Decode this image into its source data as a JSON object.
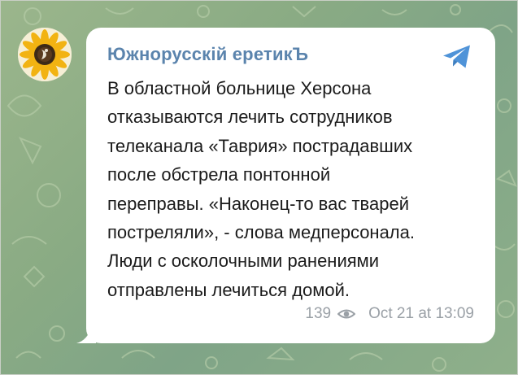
{
  "post": {
    "channel_name": "Южнорусскій еретикЪ",
    "text": "В областной больнице Херсона\nотказываются лечить сотрудников\nтелеканала «Таврия» пострадавших\nпосле обстрела понтонной\nпереправы. «Наконец-то вас тварей\nпостреляли», - слова медперсонала.\nЛюди с осколочными ранениями\nотправлены лечиться домой.",
    "views": "139",
    "timestamp": "Oct 21 at 13:09"
  },
  "icons": {
    "share": "telegram-send-icon",
    "views": "eye-icon",
    "avatar": "sunflower-logo"
  },
  "colors": {
    "sender": "#5b84ad",
    "share_icon": "#4f93d8",
    "meta": "#9aa0a6",
    "background": "#8aab84"
  }
}
